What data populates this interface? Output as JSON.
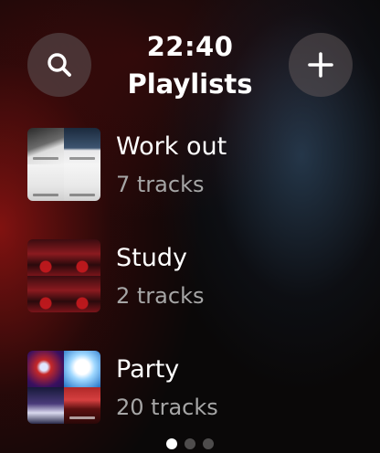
{
  "header": {
    "time": "22:40",
    "title": "Playlists",
    "search_icon": "search-icon",
    "add_icon": "plus-icon"
  },
  "playlists": [
    {
      "name": "Work out",
      "count": "7 tracks"
    },
    {
      "name": "Study",
      "count": "2 tracks"
    },
    {
      "name": "Party",
      "count": "20 tracks"
    }
  ],
  "pager": {
    "pages": 3,
    "current": 1
  },
  "colors": {
    "accent_red": "#961412",
    "button_bg": "#5f5558",
    "secondary_text": "#a6a6a6"
  }
}
